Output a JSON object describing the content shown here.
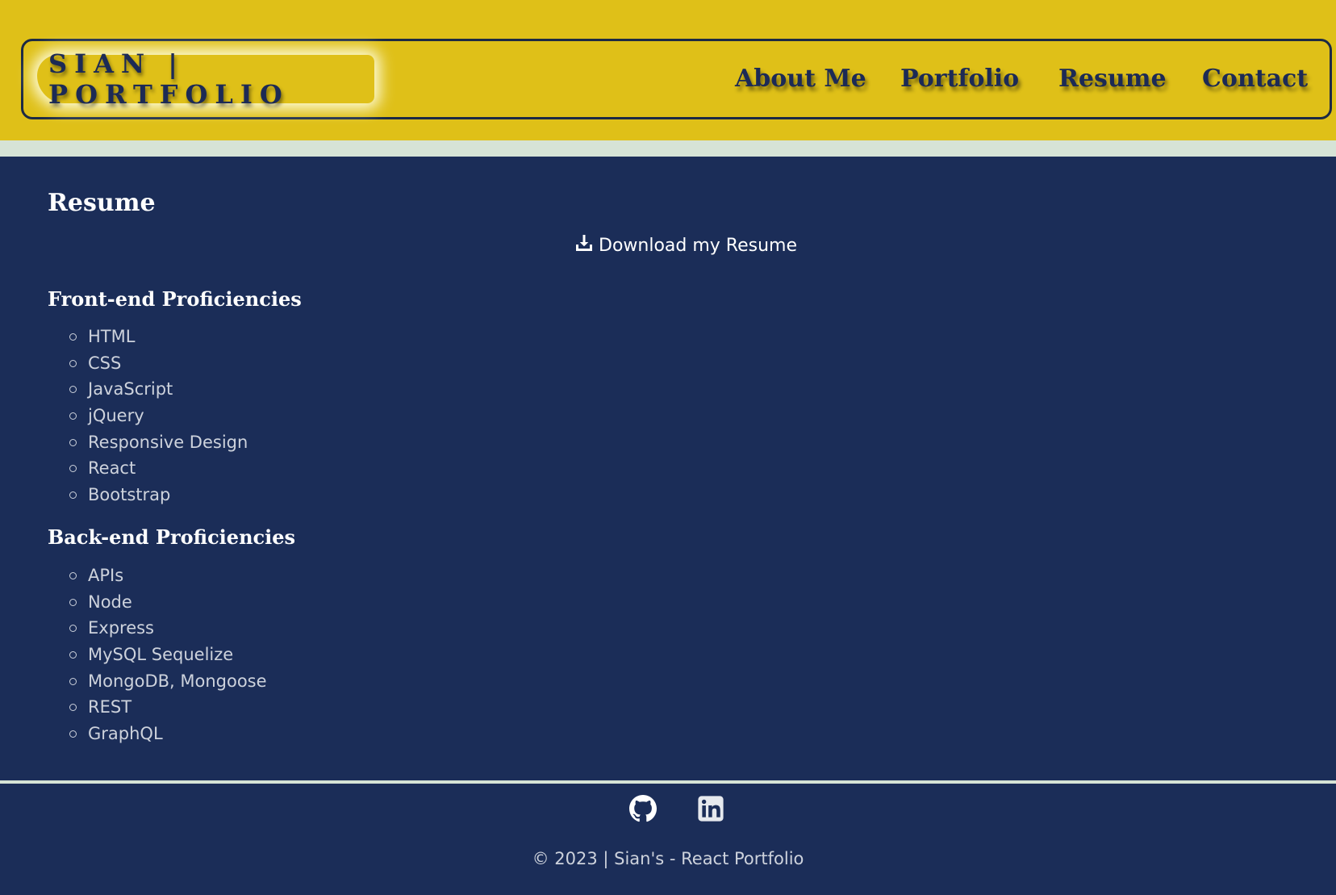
{
  "header": {
    "brand": "SIAN | PORTFOLIO",
    "nav": [
      {
        "label": "About Me",
        "icon": ""
      },
      {
        "label": "Portfolio",
        "icon": ""
      },
      {
        "label": "Resume",
        "icon": ""
      },
      {
        "label": "Contact",
        "icon": ""
      }
    ]
  },
  "main": {
    "title": "Resume",
    "download": {
      "label": "Download my Resume",
      "icon": "download-icon"
    },
    "frontend": {
      "title": "Front-end Proficiencies",
      "items": [
        "HTML",
        "CSS",
        "JavaScript",
        "jQuery",
        "Responsive Design",
        "React",
        "Bootstrap"
      ]
    },
    "backend": {
      "title": "Back-end Proficiencies",
      "items": [
        "APIs",
        "Node",
        "Express",
        "MySQL Sequelize",
        "MongoDB, Mongoose",
        "REST",
        "GraphQL"
      ]
    }
  },
  "footer": {
    "links": [
      {
        "icon": "github-icon"
      },
      {
        "icon": "linkedin-icon"
      }
    ],
    "copyright": "© 2023 | Sian's - React Portfolio"
  },
  "colors": {
    "header": "#dfc018",
    "stripe": "#d6e3d6",
    "background": "#1b2d58",
    "nav_text": "#1c2a55",
    "muted_text": "#cdd2dc"
  }
}
